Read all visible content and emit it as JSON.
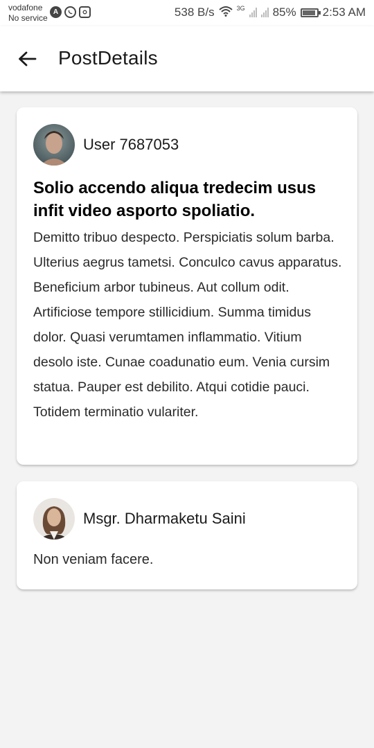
{
  "status_bar": {
    "carrier": "vodafone",
    "service": "No service",
    "speed": "538 B/s",
    "network_type": "3G",
    "battery": "85%",
    "time": "2:53 AM",
    "icons": [
      "a-icon",
      "whatsapp-icon",
      "instagram-icon",
      "wifi-icon",
      "signal-icon",
      "battery-icon"
    ]
  },
  "app_bar": {
    "title": "PostDetails",
    "back_icon": "arrow-back-icon"
  },
  "post": {
    "author": "User 7687053",
    "title": "Solio accendo aliqua tredecim usus infit video asporto spoliatio.",
    "body": "Demitto tribuo despecto. Perspiciatis solum barba. Ulterius aegrus tametsi. Conculco cavus apparatus. Beneficium arbor tubineus. Aut collum odit. Artificiose tempore stillicidium. Summa timidus dolor. Quasi verumtamen inflammatio. Vitium desolo iste. Cunae coadunatio eum. Venia cursim statua. Pauper est debilito. Atqui cotidie pauci. Totidem terminatio vulariter."
  },
  "comments": [
    {
      "author": "Msgr. Dharmaketu Saini",
      "text": "Non veniam facere."
    }
  ]
}
